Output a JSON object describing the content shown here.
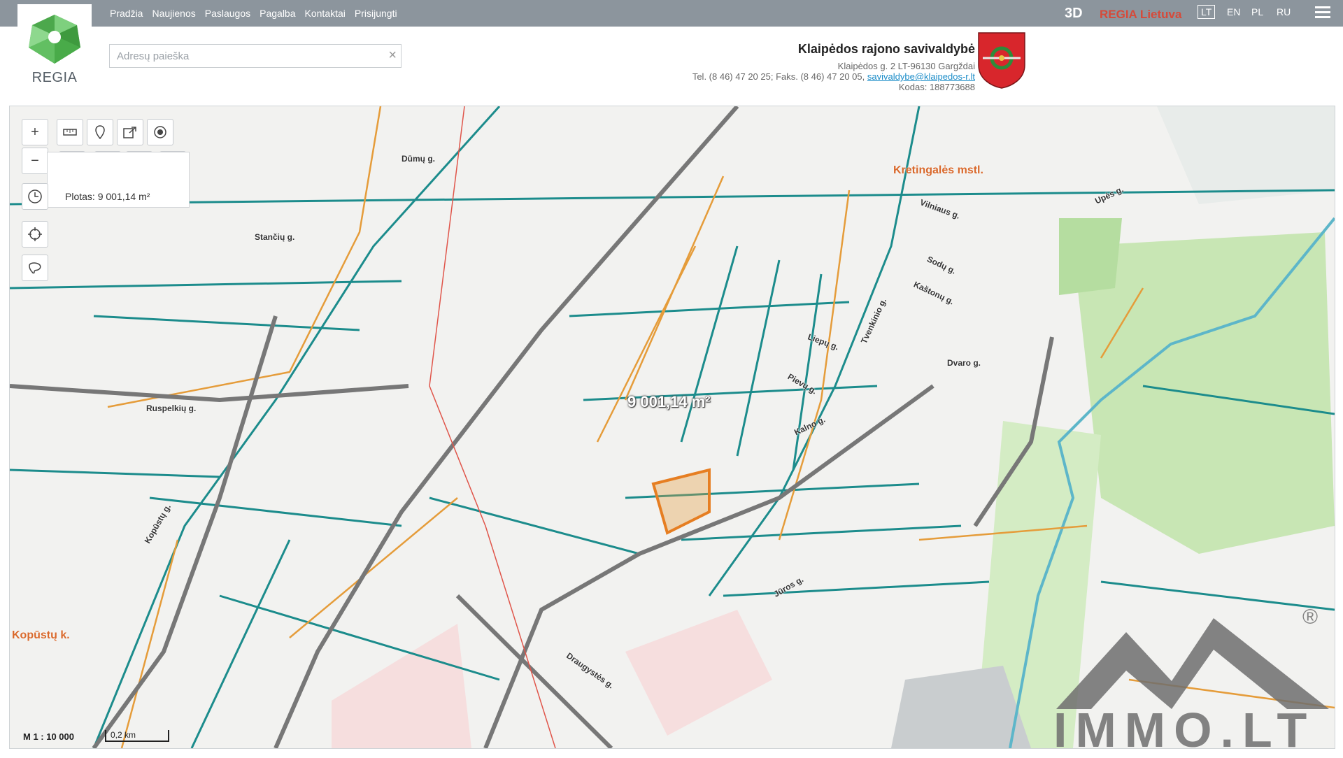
{
  "nav": [
    "Pradžia",
    "Naujienos",
    "Paslaugos",
    "Pagalba",
    "Kontaktai",
    "Prisijungti"
  ],
  "logo_text": "REGIA",
  "right_nav": {
    "btn_3d": "3D",
    "regia_lietuva": "REGIA Lietuva",
    "languages": [
      "LT",
      "EN",
      "PL",
      "RU"
    ],
    "active_language": "LT"
  },
  "search": {
    "placeholder": "Adresų paieška",
    "value": "",
    "clear_icon": "×"
  },
  "municipality": {
    "name": "Klaipėdos rajono savivaldybė",
    "address": "Klaipėdos g. 2 LT-96130 Gargždai",
    "phone_fax": "Tel. (8 46) 47 20 25; Faks. (8 46) 47 20 05,",
    "email": "savivaldybe@klaipedos-r.lt",
    "code": "Kodas: 188773688"
  },
  "map": {
    "measure_result": "Plotas: 9 001,14 m²",
    "area_label": "9 001,14 m²",
    "scale": "M 1 : 10 000",
    "scale_bar": "0,2 km",
    "place_labels": [
      "Kretingalės mstl.",
      "Kopūstų k."
    ],
    "street_labels": [
      "Dūmų g.",
      "Stančių g.",
      "Ruspelkių g.",
      "Kopūstų g.",
      "Kalno g.",
      "Vilniaus g.",
      "Liepų g.",
      "Pievų g.",
      "Kaštonų g.",
      "Sodų g.",
      "Tvenkinio g.",
      "Dvaro g.",
      "Upės g.",
      "Jūros g.",
      "Draugystės g."
    ],
    "colors": {
      "parcel": "#1c8c8c",
      "orange": "#e59c3a",
      "road": "#777777",
      "green": "#c8e6b4",
      "red": "#e0554a"
    }
  },
  "tools": {
    "zoom_in": "+",
    "zoom_out": "−",
    "icons": [
      "ruler-icon",
      "marker-icon",
      "share-icon",
      "target-icon",
      "measure-length-icon",
      "measure-area-icon",
      "clear-measure-icon",
      "trash-icon",
      "history-icon",
      "locate-icon",
      "lasso-icon"
    ]
  },
  "watermark": {
    "text": "IMMO.LT",
    "registered": "®"
  }
}
